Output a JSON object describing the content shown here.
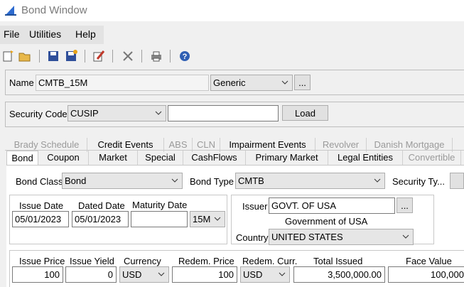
{
  "window": {
    "title": "Bond Window"
  },
  "menu": {
    "file": "File",
    "utilities": "Utilities",
    "help": "Help"
  },
  "name_row": {
    "label": "Name",
    "value": "CMTB_15M",
    "type_value": "Generic",
    "more_label": "..."
  },
  "security_code": {
    "label": "Security Code",
    "code_type": "CUSIP",
    "code_value": "",
    "load_label": "Load"
  },
  "tabs_row1": [
    {
      "label": "Brady Schedule",
      "enabled": false
    },
    {
      "label": "Credit Events",
      "enabled": true
    },
    {
      "label": "ABS",
      "enabled": false
    },
    {
      "label": "CLN",
      "enabled": false
    },
    {
      "label": "Impairment Events",
      "enabled": true
    },
    {
      "label": "Revolver",
      "enabled": false
    },
    {
      "label": "Danish Mortgage",
      "enabled": false
    }
  ],
  "tabs_row2": [
    {
      "label": "Bond",
      "enabled": true
    },
    {
      "label": "Coupon",
      "enabled": true
    },
    {
      "label": "Market",
      "enabled": true
    },
    {
      "label": "Special",
      "enabled": true
    },
    {
      "label": "CashFlows",
      "enabled": true
    },
    {
      "label": "Primary Market",
      "enabled": true
    },
    {
      "label": "Legal Entities",
      "enabled": true
    },
    {
      "label": "Convertible",
      "enabled": false
    }
  ],
  "bond": {
    "class_label": "Bond Class",
    "class_value": "Bond",
    "type_label": "Bond Type",
    "type_value": "CMTB",
    "security_type_label": "Security Ty...",
    "issue_date_label": "Issue Date",
    "issue_date": "05/01/2023",
    "dated_date_label": "Dated Date",
    "dated_date": "05/01/2023",
    "maturity_label": "Maturity Date",
    "maturity_value": "",
    "tenor": "15M",
    "issuer_label": "Issuer",
    "issuer_value": "GOVT. OF USA",
    "issuer_name": "Government of USA",
    "country_label": "Country",
    "country_value": "UNITED STATES"
  },
  "pricing": {
    "issue_price_label": "Issue Price",
    "issue_price": "100",
    "issue_yield_label": "Issue Yield",
    "issue_yield": "0",
    "currency_label": "Currency",
    "currency": "USD",
    "redem_price_label": "Redem. Price",
    "redem_price": "100",
    "redem_curr_label": "Redem. Curr.",
    "redem_curr": "USD",
    "total_issued_label": "Total Issued",
    "total_issued": "3,500,000.00",
    "face_value_label": "Face Value",
    "face_value": "100,000"
  },
  "icons": [
    "new-icon",
    "open-icon",
    "save-icon",
    "save-as-icon",
    "edit-icon",
    "delete-icon",
    "print-icon",
    "help-icon"
  ],
  "colors": {
    "titlebar": "#ffffff",
    "background": "#f0f0f0",
    "accent": "#1e5aa8"
  }
}
